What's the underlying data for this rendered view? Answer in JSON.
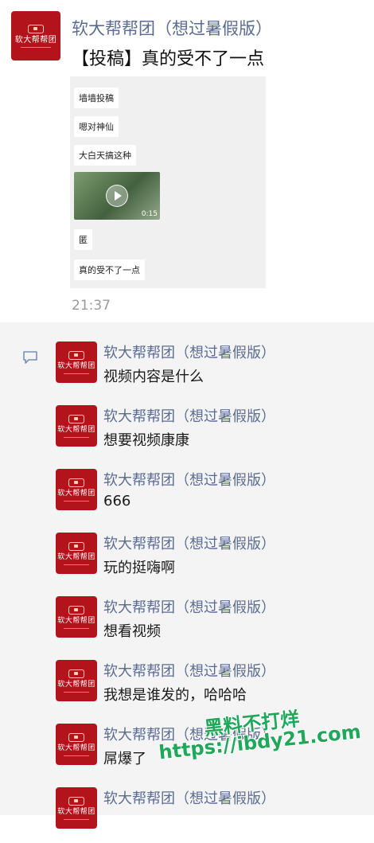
{
  "post": {
    "account_name": "软大帮帮团（想过暑假版）",
    "title": "【投稿】真的受不了一点",
    "image_messages": [
      "墙墙投稿",
      "嗯对神仙",
      "大白天搞这种",
      "匿",
      "真的受不了一点"
    ],
    "video_duration": "0:15",
    "time": "21:37"
  },
  "avatar": {
    "text": "软大帮帮团"
  },
  "comment_icon": "comment-icon",
  "comments": [
    {
      "name": "软大帮帮团（想过暑假版）",
      "text": "视频内容是什么"
    },
    {
      "name": "软大帮帮团（想过暑假版）",
      "text": "想要视频康康"
    },
    {
      "name": "软大帮帮团（想过暑假版）",
      "text": "666"
    },
    {
      "name": "软大帮帮团（想过暑假版）",
      "text": "玩的挺嗨啊"
    },
    {
      "name": "软大帮帮团（想过暑假版）",
      "text": "想看视频"
    },
    {
      "name": "软大帮帮团（想过暑假版）",
      "text": "我想是谁发的，哈哈哈"
    },
    {
      "name": "软大帮帮团（想过暑假版）",
      "text": "屌爆了"
    },
    {
      "name": "软大帮帮团（想过暑假版）",
      "text": ""
    }
  ],
  "watermark": {
    "line1": "黑料不打烊",
    "line2": "https://ibdy21.com"
  },
  "colors": {
    "brand_red": "#b3141b",
    "name_blue": "#5b6c90",
    "watermark_green": "#1fa85a"
  }
}
